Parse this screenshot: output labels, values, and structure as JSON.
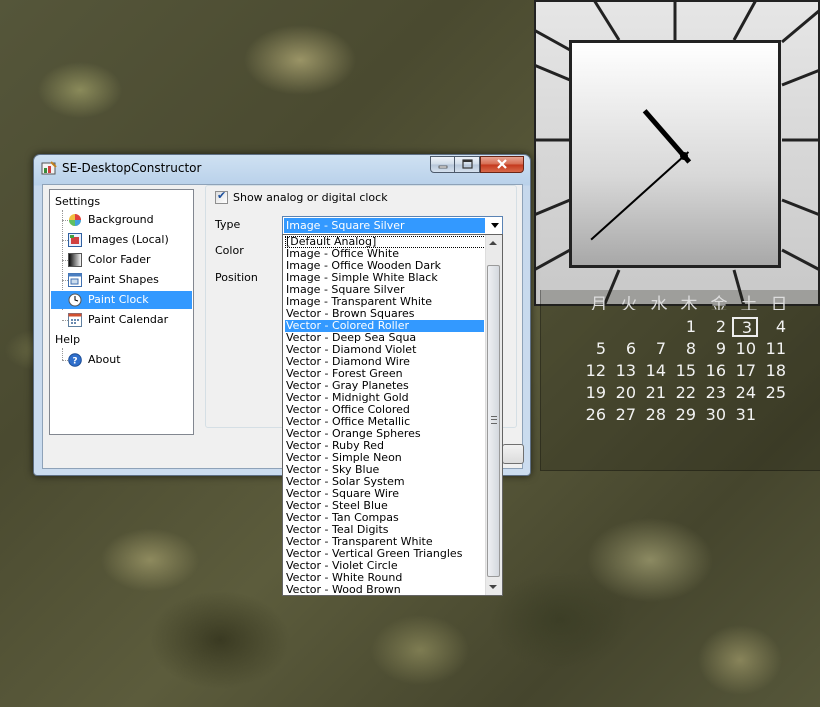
{
  "window": {
    "title": "SE-DesktopConstructor"
  },
  "tree": {
    "settings_label": "Settings",
    "items": [
      {
        "label": "Background",
        "icon": "color-wheel-icon"
      },
      {
        "label": "Images (Local)",
        "icon": "images-icon"
      },
      {
        "label": "Color Fader",
        "icon": "gradient-icon"
      },
      {
        "label": "Paint Shapes",
        "icon": "shapes-icon"
      },
      {
        "label": "Paint Clock",
        "icon": "clock-icon"
      },
      {
        "label": "Paint Calendar",
        "icon": "calendar-icon"
      }
    ],
    "selected": "Paint Clock",
    "help_label": "Help",
    "help_items": [
      {
        "label": "About",
        "icon": "help-icon"
      }
    ]
  },
  "panel": {
    "show_clock_label": "Show analog or digital clock",
    "show_clock_checked": true,
    "type_label": "Type",
    "type_value": "Image - Square Silver",
    "color_label": "Color",
    "position_label": "Position"
  },
  "dropdown": {
    "options": [
      "[Default Analog]",
      "Image - Office White",
      "Image - Office Wooden Dark",
      "Image - Simple White Black",
      "Image - Square Silver",
      "Image - Transparent White",
      "Vector - Brown Squares",
      "Vector - Colored Roller",
      "Vector - Deep Sea Squa",
      "Vector - Diamond Violet",
      "Vector - Diamond Wire",
      "Vector - Forest Green",
      "Vector - Gray Planetes",
      "Vector - Midnight Gold",
      "Vector - Office Colored",
      "Vector - Office Metallic",
      "Vector - Orange Spheres",
      "Vector - Ruby Red",
      "Vector - Simple Neon",
      "Vector - Sky Blue",
      "Vector - Solar System",
      "Vector - Square Wire",
      "Vector - Steel Blue",
      "Vector - Tan Compas",
      "Vector - Teal Digits",
      "Vector - Transparent White",
      "Vector - Vertical Green Triangles",
      "Vector - Violet Circle",
      "Vector - White Round",
      "Vector - Wood Brown"
    ],
    "highlighted": "Vector - Colored Roller"
  },
  "calendar": {
    "weekdays": [
      "月",
      "火",
      "水",
      "木",
      "金",
      "土",
      "日"
    ],
    "leading_blanks": 3,
    "days": [
      "1",
      "2",
      "3",
      "4",
      "5",
      "6",
      "7",
      "8",
      "9",
      "10",
      "11",
      "12",
      "13",
      "14",
      "15",
      "16",
      "17",
      "18",
      "19",
      "20",
      "21",
      "22",
      "23",
      "24",
      "25",
      "26",
      "27",
      "28",
      "29",
      "30",
      "31"
    ],
    "today": "3"
  },
  "clock": {
    "hour": 10,
    "minute": 38
  },
  "colors": {
    "selection": "#3399ff",
    "clock_hands": "#000000"
  }
}
